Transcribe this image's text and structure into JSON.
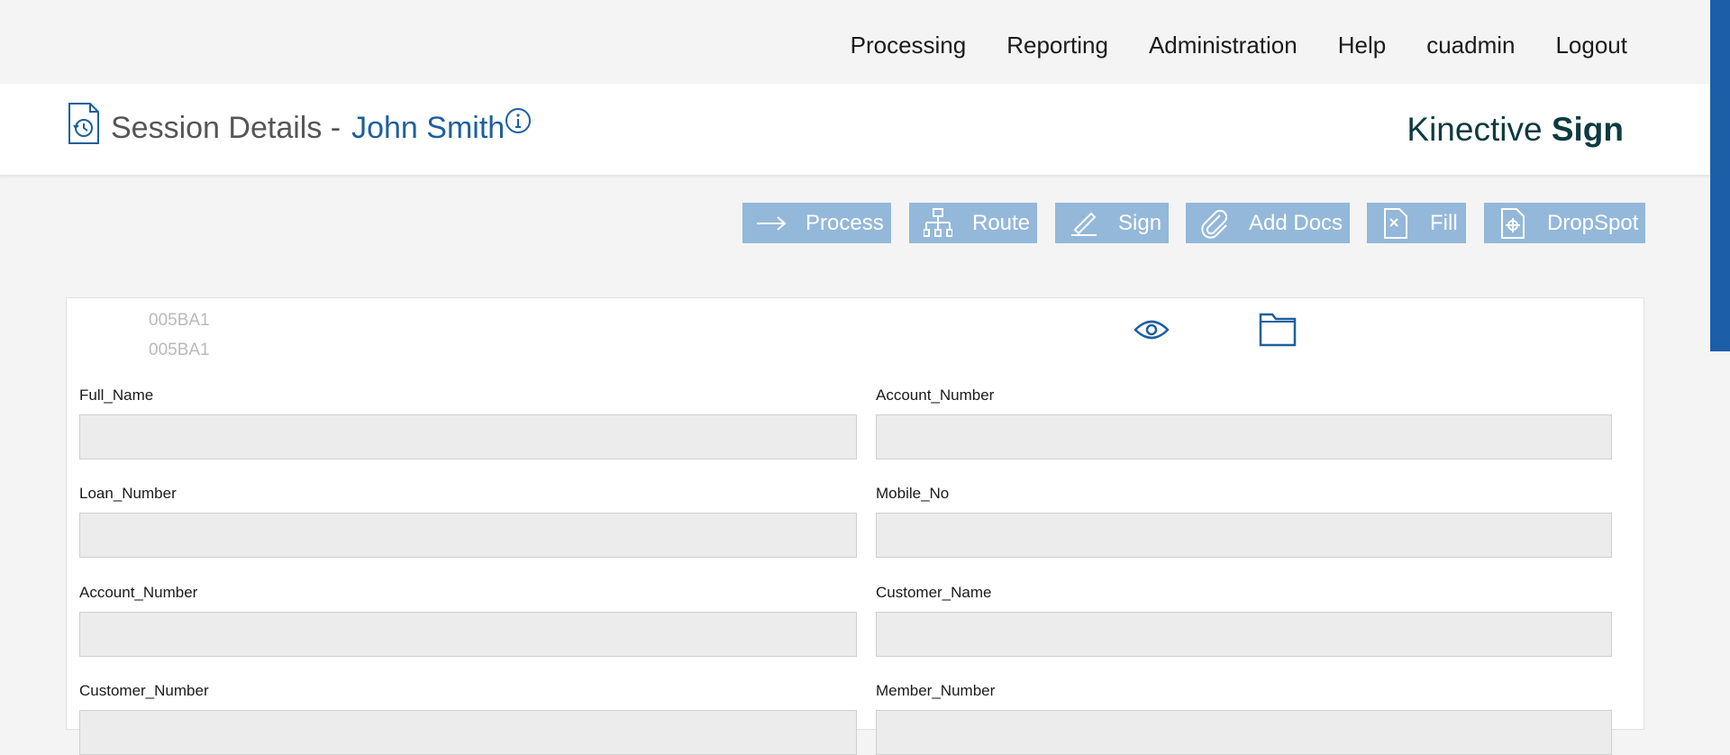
{
  "nav": {
    "items": [
      "Processing",
      "Reporting",
      "Administration",
      "Help",
      "cuadmin",
      "Logout"
    ]
  },
  "header": {
    "title_prefix": "Session Details -",
    "title_name": "John Smith",
    "brand_light": "Kinective",
    "brand_bold": "Sign"
  },
  "toolbar": {
    "buttons": [
      {
        "label": "Process",
        "icon": "arrow-right-icon"
      },
      {
        "label": "Route",
        "icon": "org-chart-icon"
      },
      {
        "label": "Sign",
        "icon": "pen-sign-icon"
      },
      {
        "label": "Add Docs",
        "icon": "paperclip-icon"
      },
      {
        "label": "Fill",
        "icon": "document-fill-icon"
      },
      {
        "label": "DropSpot",
        "icon": "document-target-icon"
      }
    ]
  },
  "document": {
    "codes": [
      "005BA1",
      "005BA1"
    ],
    "fields": [
      {
        "label": "Full_Name",
        "value": ""
      },
      {
        "label": "Account_Number",
        "value": ""
      },
      {
        "label": "Loan_Number",
        "value": ""
      },
      {
        "label": "Mobile_No",
        "value": ""
      },
      {
        "label": "Account_Number",
        "value": ""
      },
      {
        "label": "Customer_Name",
        "value": ""
      },
      {
        "label": "Customer_Number",
        "value": ""
      },
      {
        "label": "Member_Number",
        "value": ""
      }
    ]
  },
  "colors": {
    "accent": "#1e5f9e",
    "toolbar_button": "#94b8d9",
    "brand": "#0d3b40",
    "scroll_thumb": "#1d5ea8"
  }
}
